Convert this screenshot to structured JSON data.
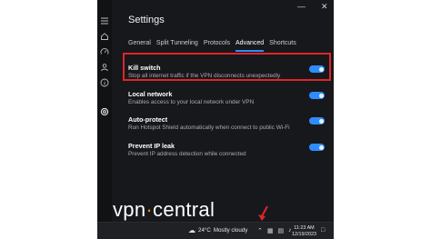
{
  "window": {
    "title": "Settings",
    "controls": {
      "minimize": "—",
      "close": "✕"
    }
  },
  "sidebar": {
    "icons": [
      "menu-icon",
      "home-icon",
      "speed-icon",
      "account-icon",
      "info-icon",
      "settings-icon"
    ]
  },
  "tabs": [
    {
      "label": "General",
      "active": false
    },
    {
      "label": "Split Tunneling",
      "active": false
    },
    {
      "label": "Protocols",
      "active": false
    },
    {
      "label": "Advanced",
      "active": true
    },
    {
      "label": "Shortcuts",
      "active": false
    }
  ],
  "settings": [
    {
      "name": "Kill switch",
      "description": "Stop all internet traffic if the VPN disconnects unexpectedly",
      "enabled": true,
      "highlighted": true
    },
    {
      "name": "Local network",
      "description": "Enables access to your local network under VPN",
      "enabled": true,
      "highlighted": false
    },
    {
      "name": "Auto-protect",
      "description": "Run Hotspot Shield automatically when connect to public Wi-Fi",
      "enabled": true,
      "highlighted": false
    },
    {
      "name": "Prevent IP leak",
      "description": "Prevent IP address detection while connected",
      "enabled": true,
      "highlighted": false
    }
  ],
  "watermark": {
    "part1": "vpn",
    "dot": "·",
    "part2": "central"
  },
  "taskbar": {
    "weather_temp": "24°C",
    "weather_desc": "Mostly cloudy",
    "time": "11:23 AM",
    "date": "12/19/2023"
  },
  "colors": {
    "accent": "#2f8cff",
    "highlight_border": "#e0252b",
    "window_bg": "#17181b",
    "watermark_dot": "#ff8a1f"
  }
}
